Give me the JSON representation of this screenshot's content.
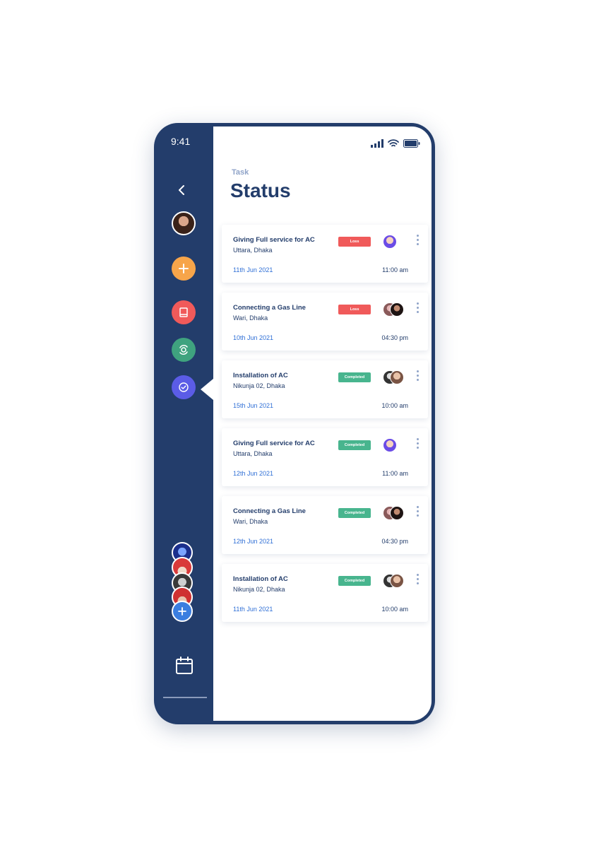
{
  "status_bar": {
    "time": "9:41"
  },
  "header": {
    "label": "Task",
    "title": "Status"
  },
  "colors": {
    "sidebar": "#233d6b",
    "add": "#f7a54a",
    "book": "#f05a5a",
    "sync": "#3fa37f",
    "check": "#5b5ce6",
    "loss": "#f05a5a",
    "completed": "#48b58e",
    "date": "#2f6fd6"
  },
  "sidebar": {
    "icons": [
      "back-icon",
      "profile-avatar",
      "plus-icon",
      "book-icon",
      "sync-icon",
      "check-circle-icon",
      "calendar-icon"
    ]
  },
  "tasks": [
    {
      "title": "Giving Full service for AC",
      "location": "Uttara, Dhaka",
      "status": "Loss",
      "date": "11th Jun 2021",
      "time": "11:00 am",
      "assignees": 1
    },
    {
      "title": "Connecting a Gas Line",
      "location": "Wari, Dhaka",
      "status": "Loss",
      "date": "10th Jun 2021",
      "time": "04:30 pm",
      "assignees": 2
    },
    {
      "title": "Installation of AC",
      "location": "Nikunja 02, Dhaka",
      "status": "Completed",
      "date": "15th Jun 2021",
      "time": "10:00 am",
      "assignees": 2
    },
    {
      "title": "Giving Full service for AC",
      "location": "Uttara, Dhaka",
      "status": "Completed",
      "date": "12th Jun 2021",
      "time": "11:00 am",
      "assignees": 1
    },
    {
      "title": "Connecting a Gas Line",
      "location": "Wari, Dhaka",
      "status": "Completed",
      "date": "12th Jun 2021",
      "time": "04:30 pm",
      "assignees": 2
    },
    {
      "title": "Installation of AC",
      "location": "Nikunja 02, Dhaka",
      "status": "Completed",
      "date": "11th Jun 2021",
      "time": "10:00 am",
      "assignees": 2
    }
  ]
}
